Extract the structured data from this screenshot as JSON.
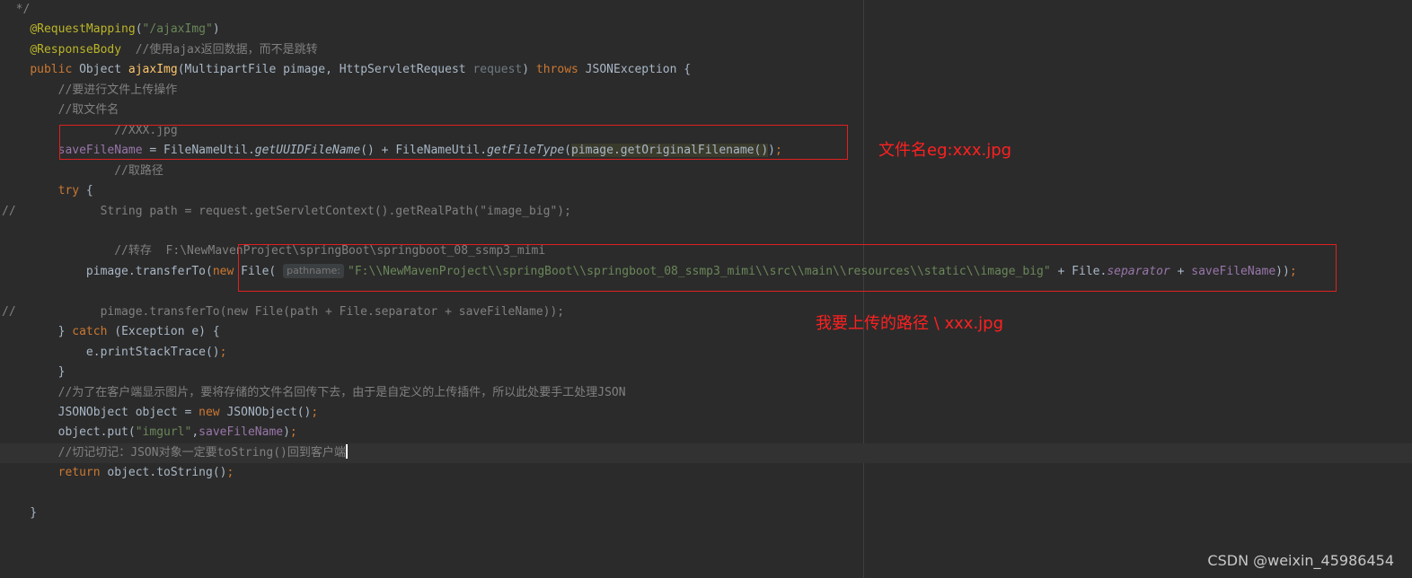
{
  "editor": {
    "lines": [
      {
        "tokens": [
          {
            "t": "  */",
            "c": "cmt"
          }
        ]
      },
      {
        "tokens": [
          {
            "t": "    "
          },
          {
            "t": "@RequestMapping",
            "c": "anno"
          },
          {
            "t": "("
          },
          {
            "t": "\"/ajaxImg\"",
            "c": "str"
          },
          {
            "t": ")"
          }
        ]
      },
      {
        "tokens": [
          {
            "t": "    "
          },
          {
            "t": "@ResponseBody",
            "c": "anno"
          },
          {
            "t": "  "
          },
          {
            "t": "//使用ajax返回数据，而不是跳转",
            "c": "cmt"
          }
        ]
      },
      {
        "tokens": [
          {
            "t": "    "
          },
          {
            "t": "public",
            "c": "kw"
          },
          {
            "t": " Object "
          },
          {
            "t": "ajaxImg",
            "c": "fn"
          },
          {
            "t": "(MultipartFile pimage, HttpServletRequest "
          },
          {
            "t": "request",
            "c": "unused"
          },
          {
            "t": ") "
          },
          {
            "t": "throws",
            "c": "kw"
          },
          {
            "t": " JSONException {"
          }
        ]
      },
      {
        "tokens": [
          {
            "t": "        "
          },
          {
            "t": "//要进行文件上传操作",
            "c": "cmt"
          }
        ]
      },
      {
        "tokens": [
          {
            "t": "        "
          },
          {
            "t": "//取文件名",
            "c": "cmt"
          }
        ]
      },
      {
        "tokens": [
          {
            "t": "                "
          },
          {
            "t": "//XXX.jpg",
            "c": "cmt"
          }
        ]
      },
      {
        "tokens": [
          {
            "t": "        "
          },
          {
            "t": "saveFileName",
            "c": "field"
          },
          {
            "t": " = FileNameUtil."
          },
          {
            "t": "getUUIDFileName",
            "c": "static"
          },
          {
            "t": "() + FileNameUtil."
          },
          {
            "t": "getFileType",
            "c": "static"
          },
          {
            "t": "("
          },
          {
            "t": "pimage.getOriginalFilename()",
            "c": "hl"
          },
          {
            "t": ")"
          },
          {
            "t": ";",
            "c": "kw"
          }
        ]
      },
      {
        "tokens": [
          {
            "t": "                "
          },
          {
            "t": "//取路径",
            "c": "cmt"
          }
        ]
      },
      {
        "tokens": [
          {
            "t": "        "
          },
          {
            "t": "try",
            "c": "kw"
          },
          {
            "t": " {"
          }
        ]
      },
      {
        "tokens": [
          {
            "t": "//",
            "c": "cmt"
          },
          {
            "t": "            String path = request.getServletContext().getRealPath(\"image_big\");",
            "c": "cmt"
          }
        ]
      },
      {
        "tokens": []
      },
      {
        "tokens": [
          {
            "t": "                "
          },
          {
            "t": "//转存  F:\\NewMavenProject\\springBoot\\springboot_08_ssmp3_mimi",
            "c": "cmt"
          }
        ]
      },
      {
        "tokens": [
          {
            "t": "            pimage.transferTo("
          },
          {
            "t": "new",
            "c": "kw"
          },
          {
            "t": " File( "
          },
          {
            "t": "pathname:",
            "c": "hint"
          },
          {
            "t": "\"F:\\\\NewMavenProject\\\\springBoot\\\\springboot_08_ssmp3_mimi\\\\src\\\\main\\\\resources\\\\static\\\\image_big\"",
            "c": "str"
          },
          {
            "t": " + File."
          },
          {
            "t": "separator",
            "c": "staticf"
          },
          {
            "t": " + "
          },
          {
            "t": "saveFileName",
            "c": "field"
          },
          {
            "t": "))"
          },
          {
            "t": ";",
            "c": "kw"
          }
        ]
      },
      {
        "tokens": []
      },
      {
        "tokens": [
          {
            "t": "//",
            "c": "cmt"
          },
          {
            "t": "            pimage.transferTo(new File(path + File.separator + saveFileName));",
            "c": "cmt"
          }
        ]
      },
      {
        "tokens": [
          {
            "t": "        } "
          },
          {
            "t": "catch",
            "c": "kw"
          },
          {
            "t": " (Exception e) {"
          }
        ]
      },
      {
        "tokens": [
          {
            "t": "            e.printStackTrace()"
          },
          {
            "t": ";",
            "c": "kw"
          }
        ]
      },
      {
        "tokens": [
          {
            "t": "        }"
          }
        ]
      },
      {
        "tokens": [
          {
            "t": "        "
          },
          {
            "t": "//为了在客户端显示图片，要将存储的文件名回传下去，由于是自定义的上传插件，所以此处要手工处理JSON",
            "c": "cmt"
          }
        ]
      },
      {
        "tokens": [
          {
            "t": "        JSONObject object = "
          },
          {
            "t": "new",
            "c": "kw"
          },
          {
            "t": " JSONObject()"
          },
          {
            "t": ";",
            "c": "kw"
          }
        ]
      },
      {
        "tokens": [
          {
            "t": "        object.put("
          },
          {
            "t": "\"imgurl\"",
            "c": "str"
          },
          {
            "t": ","
          },
          {
            "t": "saveFileName",
            "c": "field"
          },
          {
            "t": ")"
          },
          {
            "t": ";",
            "c": "kw"
          }
        ]
      },
      {
        "tokens": [
          {
            "t": "        "
          },
          {
            "t": "//切记切记：JSON对象一定要toString()回到客户端",
            "c": "cmt"
          }
        ],
        "caret": true,
        "current": true
      },
      {
        "tokens": [
          {
            "t": "        "
          },
          {
            "t": "return",
            "c": "kw"
          },
          {
            "t": " object.toString()"
          },
          {
            "t": ";",
            "c": "kw"
          }
        ]
      },
      {
        "tokens": []
      },
      {
        "tokens": [
          {
            "t": "    }"
          }
        ]
      }
    ]
  },
  "annotations": {
    "filename_note": "文件名eg:xxx.jpg",
    "path_note": "我要上传的路径 \\ xxx.jpg"
  },
  "watermark": "CSDN @weixin_45986454"
}
